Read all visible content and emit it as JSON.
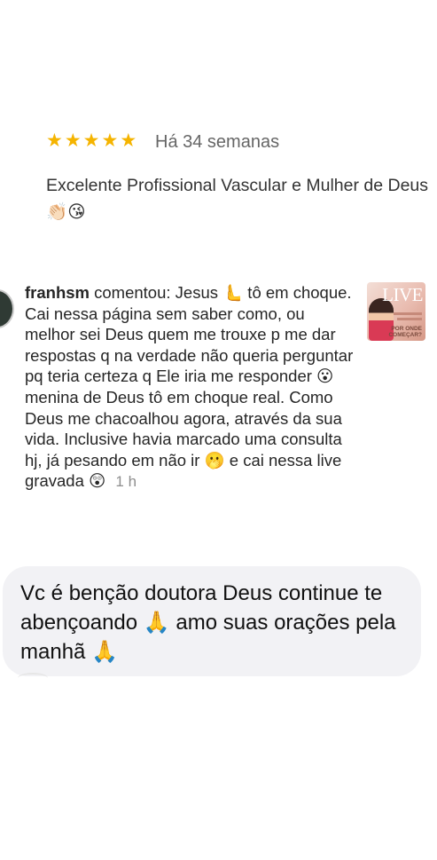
{
  "review": {
    "stars": [
      "★",
      "★",
      "★",
      "★",
      "★"
    ],
    "rating_value": 5,
    "time": "Há 34 semanas",
    "text": "Excelente Profissional Vascular e Mulher de Deus",
    "emojis": "👏🏻😘",
    "star_color": "#f5b400"
  },
  "comment": {
    "username": "franhsm",
    "text": "comentou: Jesus 🫷 tô em choque. Cai nessa página sem saber como, ou melhor sei Deus quem me trouxe p me dar respostas q na verdade não queria perguntar pq teria certeza q Ele iria me responder 😮 menina de Deus tô em choque real. Como Deus me chacoalhou agora, através da sua vida. Inclusive havia marcado uma consulta hj, já pesando em não ir 🫢 e cai nessa live gravada 😲",
    "time": "1 h",
    "thumbnail": {
      "title": "LIVE",
      "cta": "POR ONDE\nCOMEÇAR?"
    }
  },
  "message": {
    "text": "Vc é benção doutora Deus continue te abençoando 🙏 amo suas orações pela manhã 🙏",
    "bubble_color": "#f2f2f5"
  }
}
